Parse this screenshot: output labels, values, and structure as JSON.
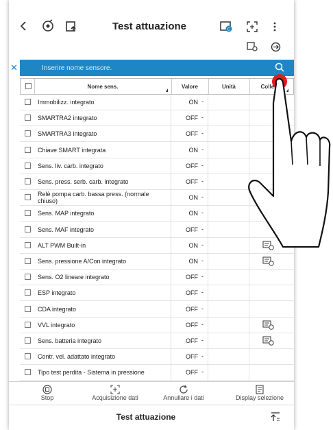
{
  "header": {
    "back_icon": "chevron-left",
    "title": "Test attuazione",
    "icons": [
      "vehicle-scan-icon",
      "ecu-upload-icon",
      "folder-icon",
      "fullscreen-icon",
      "more-icon"
    ],
    "folder_badge": "C",
    "secondary_icons": [
      "record-icon",
      "settings-gear-icon"
    ]
  },
  "search": {
    "placeholder": "Inserire nome sensore."
  },
  "table": {
    "columns": [
      "Nome sens.",
      "Valore",
      "Unità",
      "Colleg."
    ],
    "rows": [
      {
        "name": "Immobilizz. integrato",
        "value": "ON",
        "unit": "-",
        "graph": false
      },
      {
        "name": "SMARTRA2 integrato",
        "value": "OFF",
        "unit": "-",
        "graph": false
      },
      {
        "name": "SMARTRA3 integrato",
        "value": "OFF",
        "unit": "-",
        "graph": false
      },
      {
        "name": "Chiave SMART integrata",
        "value": "ON",
        "unit": "-",
        "graph": false
      },
      {
        "name": "Sens. liv. carb. integrato",
        "value": "OFF",
        "unit": "-",
        "graph": false
      },
      {
        "name": "Sens. press. serb. carb. integrato",
        "value": "OFF",
        "unit": "-",
        "graph": false
      },
      {
        "name": "Relè pompa carb. bassa press. (normale chiuso)",
        "value": "ON",
        "unit": "-",
        "graph": false
      },
      {
        "name": "Sens. MAP integrato",
        "value": "ON",
        "unit": "-",
        "graph": true
      },
      {
        "name": "Sens. MAF integrato",
        "value": "OFF",
        "unit": "-",
        "graph": false
      },
      {
        "name": "ALT PWM Built-in",
        "value": "ON",
        "unit": "-",
        "graph": true
      },
      {
        "name": "Sens. pressione A/Con integrato",
        "value": "ON",
        "unit": "-",
        "graph": true
      },
      {
        "name": "Sens. O2 lineare integrato",
        "value": "OFF",
        "unit": "-",
        "graph": false
      },
      {
        "name": "ESP integrato",
        "value": "OFF",
        "unit": "-",
        "graph": false
      },
      {
        "name": "CDA integrato",
        "value": "OFF",
        "unit": "-",
        "graph": false
      },
      {
        "name": "VVL integrato",
        "value": "OFF",
        "unit": "-",
        "graph": true
      },
      {
        "name": "Sens. batteria integrato",
        "value": "OFF",
        "unit": "-",
        "graph": true
      },
      {
        "name": "Contr. vel. adattato integrato",
        "value": "OFF",
        "unit": "-",
        "graph": false
      },
      {
        "name": "Tipo test perdita - Sistema in pressione",
        "value": "OFF",
        "unit": "-",
        "graph": false
      }
    ]
  },
  "toolbar": {
    "stop": "Stop",
    "acquire": "Acquisizione dati",
    "cancel": "Annullare i dati",
    "display": "Display selezione"
  },
  "footer": {
    "title": "Test attuazione"
  },
  "colors": {
    "search_bar": "#1f86c6",
    "touch_indicator": "#e31b1b"
  }
}
